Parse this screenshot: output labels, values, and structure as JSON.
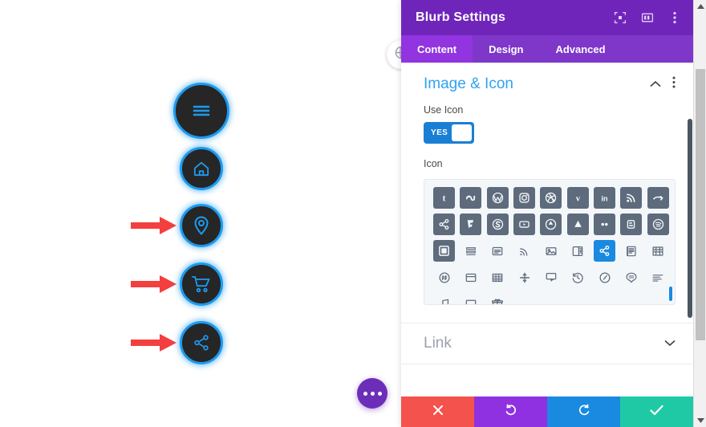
{
  "canvas": {
    "blurbs": [
      {
        "id": "menu",
        "icon_name": "hamburger-menu-icon",
        "size": 70,
        "has_arrow": false
      },
      {
        "id": "home",
        "icon_name": "home-icon",
        "size": 54,
        "has_arrow": false
      },
      {
        "id": "map",
        "icon_name": "map-pin-icon",
        "size": 54,
        "has_arrow": true
      },
      {
        "id": "cart",
        "icon_name": "shopping-cart-icon",
        "size": 54,
        "has_arrow": true
      },
      {
        "id": "share",
        "icon_name": "share-nodes-icon",
        "size": 54,
        "has_arrow": true
      }
    ],
    "arrow_color": "#f43f3f",
    "circle_bg": "#262626",
    "circle_border": "#1d9bf0",
    "fab": {
      "name": "more-options-fab",
      "icon_name": "ellipsis-icon",
      "color": "#6c2eb9"
    },
    "edge_tab": {
      "name": "page-settings-tab",
      "icon_name": "globe-icon"
    }
  },
  "panel": {
    "title": "Blurb Settings",
    "accent": "#7025ba",
    "header_icons": [
      {
        "name": "fullscreen-icon",
        "glyph": "expand"
      },
      {
        "name": "layout-columns-icon",
        "glyph": "columns"
      },
      {
        "name": "kebab-menu-icon",
        "glyph": "kebab"
      }
    ],
    "tabs": [
      {
        "label": "Content",
        "active": true
      },
      {
        "label": "Design",
        "active": false
      },
      {
        "label": "Advanced",
        "active": false
      }
    ],
    "sections": [
      {
        "title": "Image & Icon",
        "collapse_icon": "chevron-up-icon",
        "kebab_icon": "kebab-menu-icon",
        "expanded": true,
        "fields": {
          "use_icon": {
            "label": "Use Icon",
            "value": "YES",
            "on": true
          },
          "icon": {
            "label": "Icon"
          }
        }
      }
    ],
    "accordion": {
      "title": "Link",
      "chevron_icon": "chevron-down-icon",
      "expanded": false
    },
    "actions": [
      {
        "name": "cancel-button",
        "icon_name": "close-icon",
        "color": "#f4524d"
      },
      {
        "name": "undo-button",
        "icon_name": "undo-icon",
        "color": "#8f31e0"
      },
      {
        "name": "redo-button",
        "icon_name": "redo-icon",
        "color": "#1a8ae0"
      },
      {
        "name": "save-button",
        "icon_name": "check-icon",
        "color": "#20c9a6"
      }
    ],
    "icon_picker": {
      "selected_index": 24,
      "selected_color": "#1a8ae0",
      "icons": [
        {
          "name": "tumblr-icon",
          "style": "filled",
          "glyph": "t"
        },
        {
          "name": "stumbleupon-icon",
          "style": "filled",
          "glyph": "su"
        },
        {
          "name": "wordpress-icon",
          "style": "filled",
          "glyph": "w"
        },
        {
          "name": "instagram-icon",
          "style": "filled",
          "glyph": "ig"
        },
        {
          "name": "dribbble-icon",
          "style": "filled",
          "glyph": "dr"
        },
        {
          "name": "vimeo-icon",
          "style": "filled",
          "glyph": "v"
        },
        {
          "name": "linkedin-icon",
          "style": "filled",
          "glyph": "in"
        },
        {
          "name": "rss-icon",
          "style": "filled",
          "glyph": "rss"
        },
        {
          "name": "flickr-icon",
          "style": "filled",
          "glyph": "fk"
        },
        {
          "name": "share-icon",
          "style": "filled",
          "glyph": "share"
        },
        {
          "name": "foursquare-icon",
          "style": "filled",
          "glyph": "fsq"
        },
        {
          "name": "skype-icon",
          "style": "filled",
          "glyph": "s"
        },
        {
          "name": "youtube-icon",
          "style": "filled",
          "glyph": "yt"
        },
        {
          "name": "refresh-circle-icon",
          "style": "filled",
          "glyph": "ref"
        },
        {
          "name": "google-drive-icon",
          "style": "filled",
          "glyph": "drv"
        },
        {
          "name": "flickr-dots-icon",
          "style": "filled",
          "glyph": "dots"
        },
        {
          "name": "blogger-icon",
          "style": "filled",
          "glyph": "b"
        },
        {
          "name": "spotify-icon",
          "style": "filled",
          "glyph": "sp"
        },
        {
          "name": "image-frame-icon",
          "style": "filled",
          "glyph": "imgf"
        },
        {
          "name": "list-layers-icon",
          "style": "line",
          "glyph": "layers"
        },
        {
          "name": "document-icon",
          "style": "line",
          "glyph": "doc"
        },
        {
          "name": "feed-icon",
          "style": "line",
          "glyph": "feed"
        },
        {
          "name": "picture-icon",
          "style": "line",
          "glyph": "pic"
        },
        {
          "name": "sidebar-icon",
          "style": "line",
          "glyph": "sidebar"
        },
        {
          "name": "share-nodes-icon",
          "style": "selected",
          "glyph": "share"
        },
        {
          "name": "book-icon",
          "style": "line",
          "glyph": "book"
        },
        {
          "name": "grid-table-icon",
          "style": "line",
          "glyph": "grid"
        },
        {
          "name": "hashtag-circle-icon",
          "style": "line",
          "glyph": "hash"
        },
        {
          "name": "window-icon",
          "style": "line",
          "glyph": "win"
        },
        {
          "name": "table-icon",
          "style": "line",
          "glyph": "tbl"
        },
        {
          "name": "divider-icon",
          "style": "line",
          "glyph": "divide"
        },
        {
          "name": "cursor-select-icon",
          "style": "line",
          "glyph": "cursor"
        },
        {
          "name": "history-clock-icon",
          "style": "line",
          "glyph": "clock"
        },
        {
          "name": "gauge-icon",
          "style": "line",
          "glyph": "gauge"
        },
        {
          "name": "comment-lines-icon",
          "style": "line",
          "glyph": "comment"
        },
        {
          "name": "align-left-icon",
          "style": "line",
          "glyph": "align"
        },
        {
          "name": "music-note-icon",
          "style": "line",
          "glyph": "music"
        },
        {
          "name": "monitor-icon",
          "style": "line",
          "glyph": "monitor"
        },
        {
          "name": "gift-icon",
          "style": "line",
          "glyph": "gift"
        }
      ]
    }
  },
  "browser": {
    "scrollbar": {
      "name": "page-scrollbar",
      "up_icon": "triangle-up-icon",
      "down_icon": "triangle-down-icon"
    }
  }
}
